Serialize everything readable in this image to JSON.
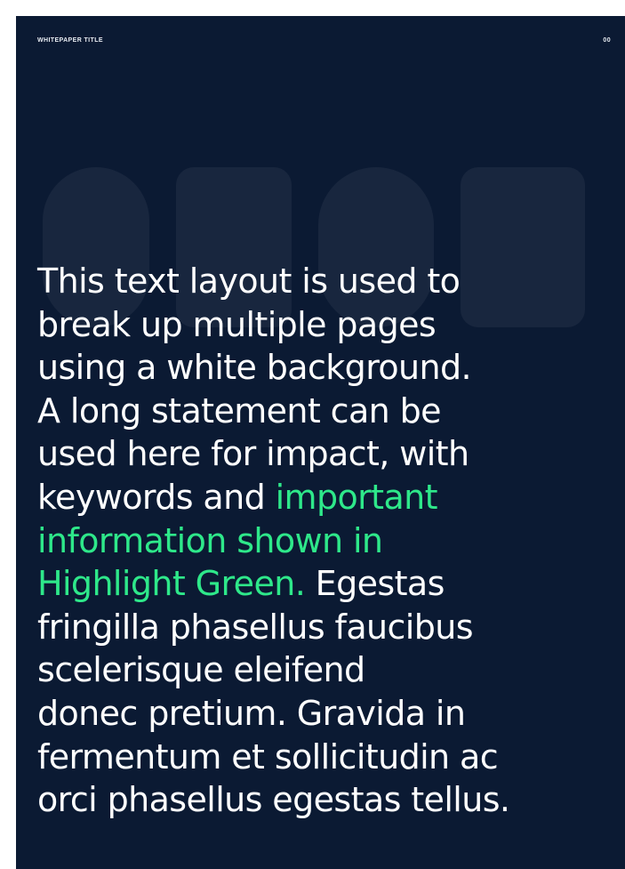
{
  "header": {
    "title": "WHITEPAPER TITLE",
    "page_number": "00"
  },
  "statement": {
    "lines": [
      "This text layout is used to",
      "break up multiple pages",
      "using a white background.",
      "A long statement can be",
      "used here for impact, with",
      "keywords and ",
      "information shown in",
      "Highlight Green.",
      "fringilla phasellus faucibus",
      "scelerisque eleifend",
      "donec pretium. Gravida in",
      "fermentum et sollicitudin ac",
      "orci phasellus egestas tellus."
    ],
    "highlight_line6": "important",
    "after_highlight_line8": " Egestas"
  },
  "colors": {
    "background": "#0b1a33",
    "text": "#ffffff",
    "highlight": "#2ee88a"
  }
}
